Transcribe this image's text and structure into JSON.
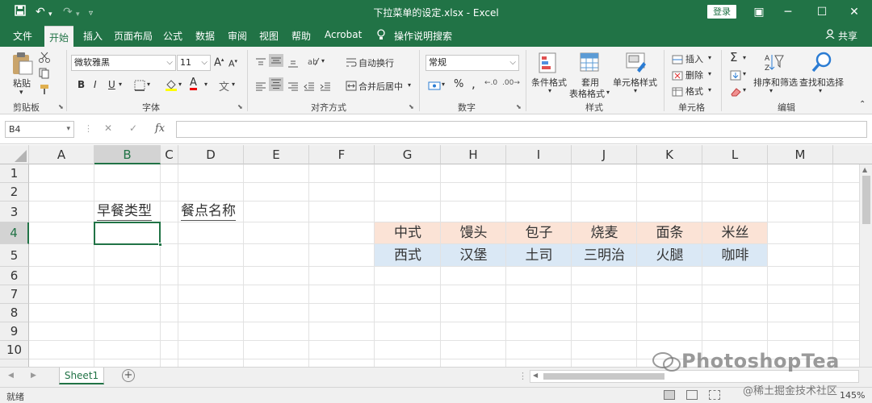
{
  "titlebar": {
    "title": "下拉菜单的设定.xlsx - Excel",
    "login": "登录",
    "icons": [
      "save-icon",
      "undo-icon",
      "redo-icon",
      "customize-icon"
    ]
  },
  "tabs": [
    "文件",
    "开始",
    "插入",
    "页面布局",
    "公式",
    "数据",
    "审阅",
    "视图",
    "帮助",
    "Acrobat"
  ],
  "tell_me": "操作说明搜索",
  "share": "共享",
  "ribbon": {
    "clipboard": {
      "label": "剪贴板",
      "paste": "粘贴"
    },
    "font": {
      "label": "字体",
      "name": "微软雅黑",
      "size": "11",
      "bold": "B",
      "italic": "I",
      "underline": "U",
      "font_color": "A",
      "bold_a": "A",
      "small_a": "A"
    },
    "alignment": {
      "label": "对齐方式",
      "wrap": "自动换行",
      "merge": "合并后居中"
    },
    "number": {
      "label": "数字",
      "format": "常规",
      "percent": "%",
      "comma": ","
    },
    "styles": {
      "label": "样式",
      "conditional": "条件格式",
      "table_1": "套用",
      "table_2": "表格格式",
      "cell_styles": "单元格样式"
    },
    "cells": {
      "label": "单元格",
      "insert": "插入",
      "delete": "删除",
      "format": "格式"
    },
    "editing": {
      "label": "编辑",
      "sort": "排序和筛选",
      "find": "查找和选择",
      "sigma": "Σ"
    }
  },
  "formula_bar": {
    "name_box": "B4",
    "fx": "fx",
    "cancel": "✕",
    "enter": "✓"
  },
  "sheet": {
    "columns": [
      "A",
      "B",
      "C",
      "D",
      "E",
      "F",
      "G",
      "H",
      "I",
      "J",
      "K",
      "L",
      "M"
    ],
    "rows": [
      "1",
      "2",
      "3",
      "4",
      "5",
      "6",
      "7",
      "8",
      "9",
      "10"
    ],
    "selected_cell": "B4",
    "B3": "早餐类型",
    "D3": "餐点名称",
    "row4": [
      "中式",
      "馒头",
      "包子",
      "烧麦",
      "面条",
      "米丝"
    ],
    "row5": [
      "西式",
      "汉堡",
      "土司",
      "三明治",
      "火腿",
      "咖啡"
    ],
    "row4_color": "#fbe3d6",
    "row5_color": "#dae8f5"
  },
  "sheet_tab": "Sheet1",
  "status": {
    "ready": "就绪",
    "zoom": "145%"
  },
  "watermark": {
    "text": "PhotoshopTea",
    "site": "@稀土掘金技术社区"
  }
}
